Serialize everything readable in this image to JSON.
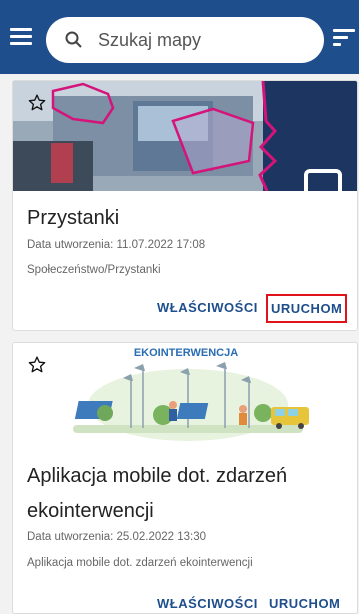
{
  "search": {
    "placeholder": "Szukaj mapy"
  },
  "maps": [
    {
      "title": "Przystanki",
      "created": "Data utworzenia: 11.07.2022 17:08",
      "category": "Społeczeństwo/Przystanki",
      "properties_label": "WŁAŚCIWOŚCI",
      "run_label": "URUCHOM"
    },
    {
      "thumbnail_title": "EKOINTERWENCJA",
      "title_line1": "Aplikacja mobile dot. zdarzeń",
      "title_line2": "ekointerwencji",
      "created": "Data utworzenia: 25.02.2022 13:30",
      "category": "Aplikacja mobile dot. zdarzeń ekointerwencji",
      "properties_label": "WŁAŚCIWOŚCI",
      "run_label": "URUCHOM"
    }
  ],
  "colors": {
    "appbar": "#1f4e8c",
    "accent": "#1f4e8c",
    "highlight": "#e0121c",
    "map_border": "#d4147a"
  }
}
